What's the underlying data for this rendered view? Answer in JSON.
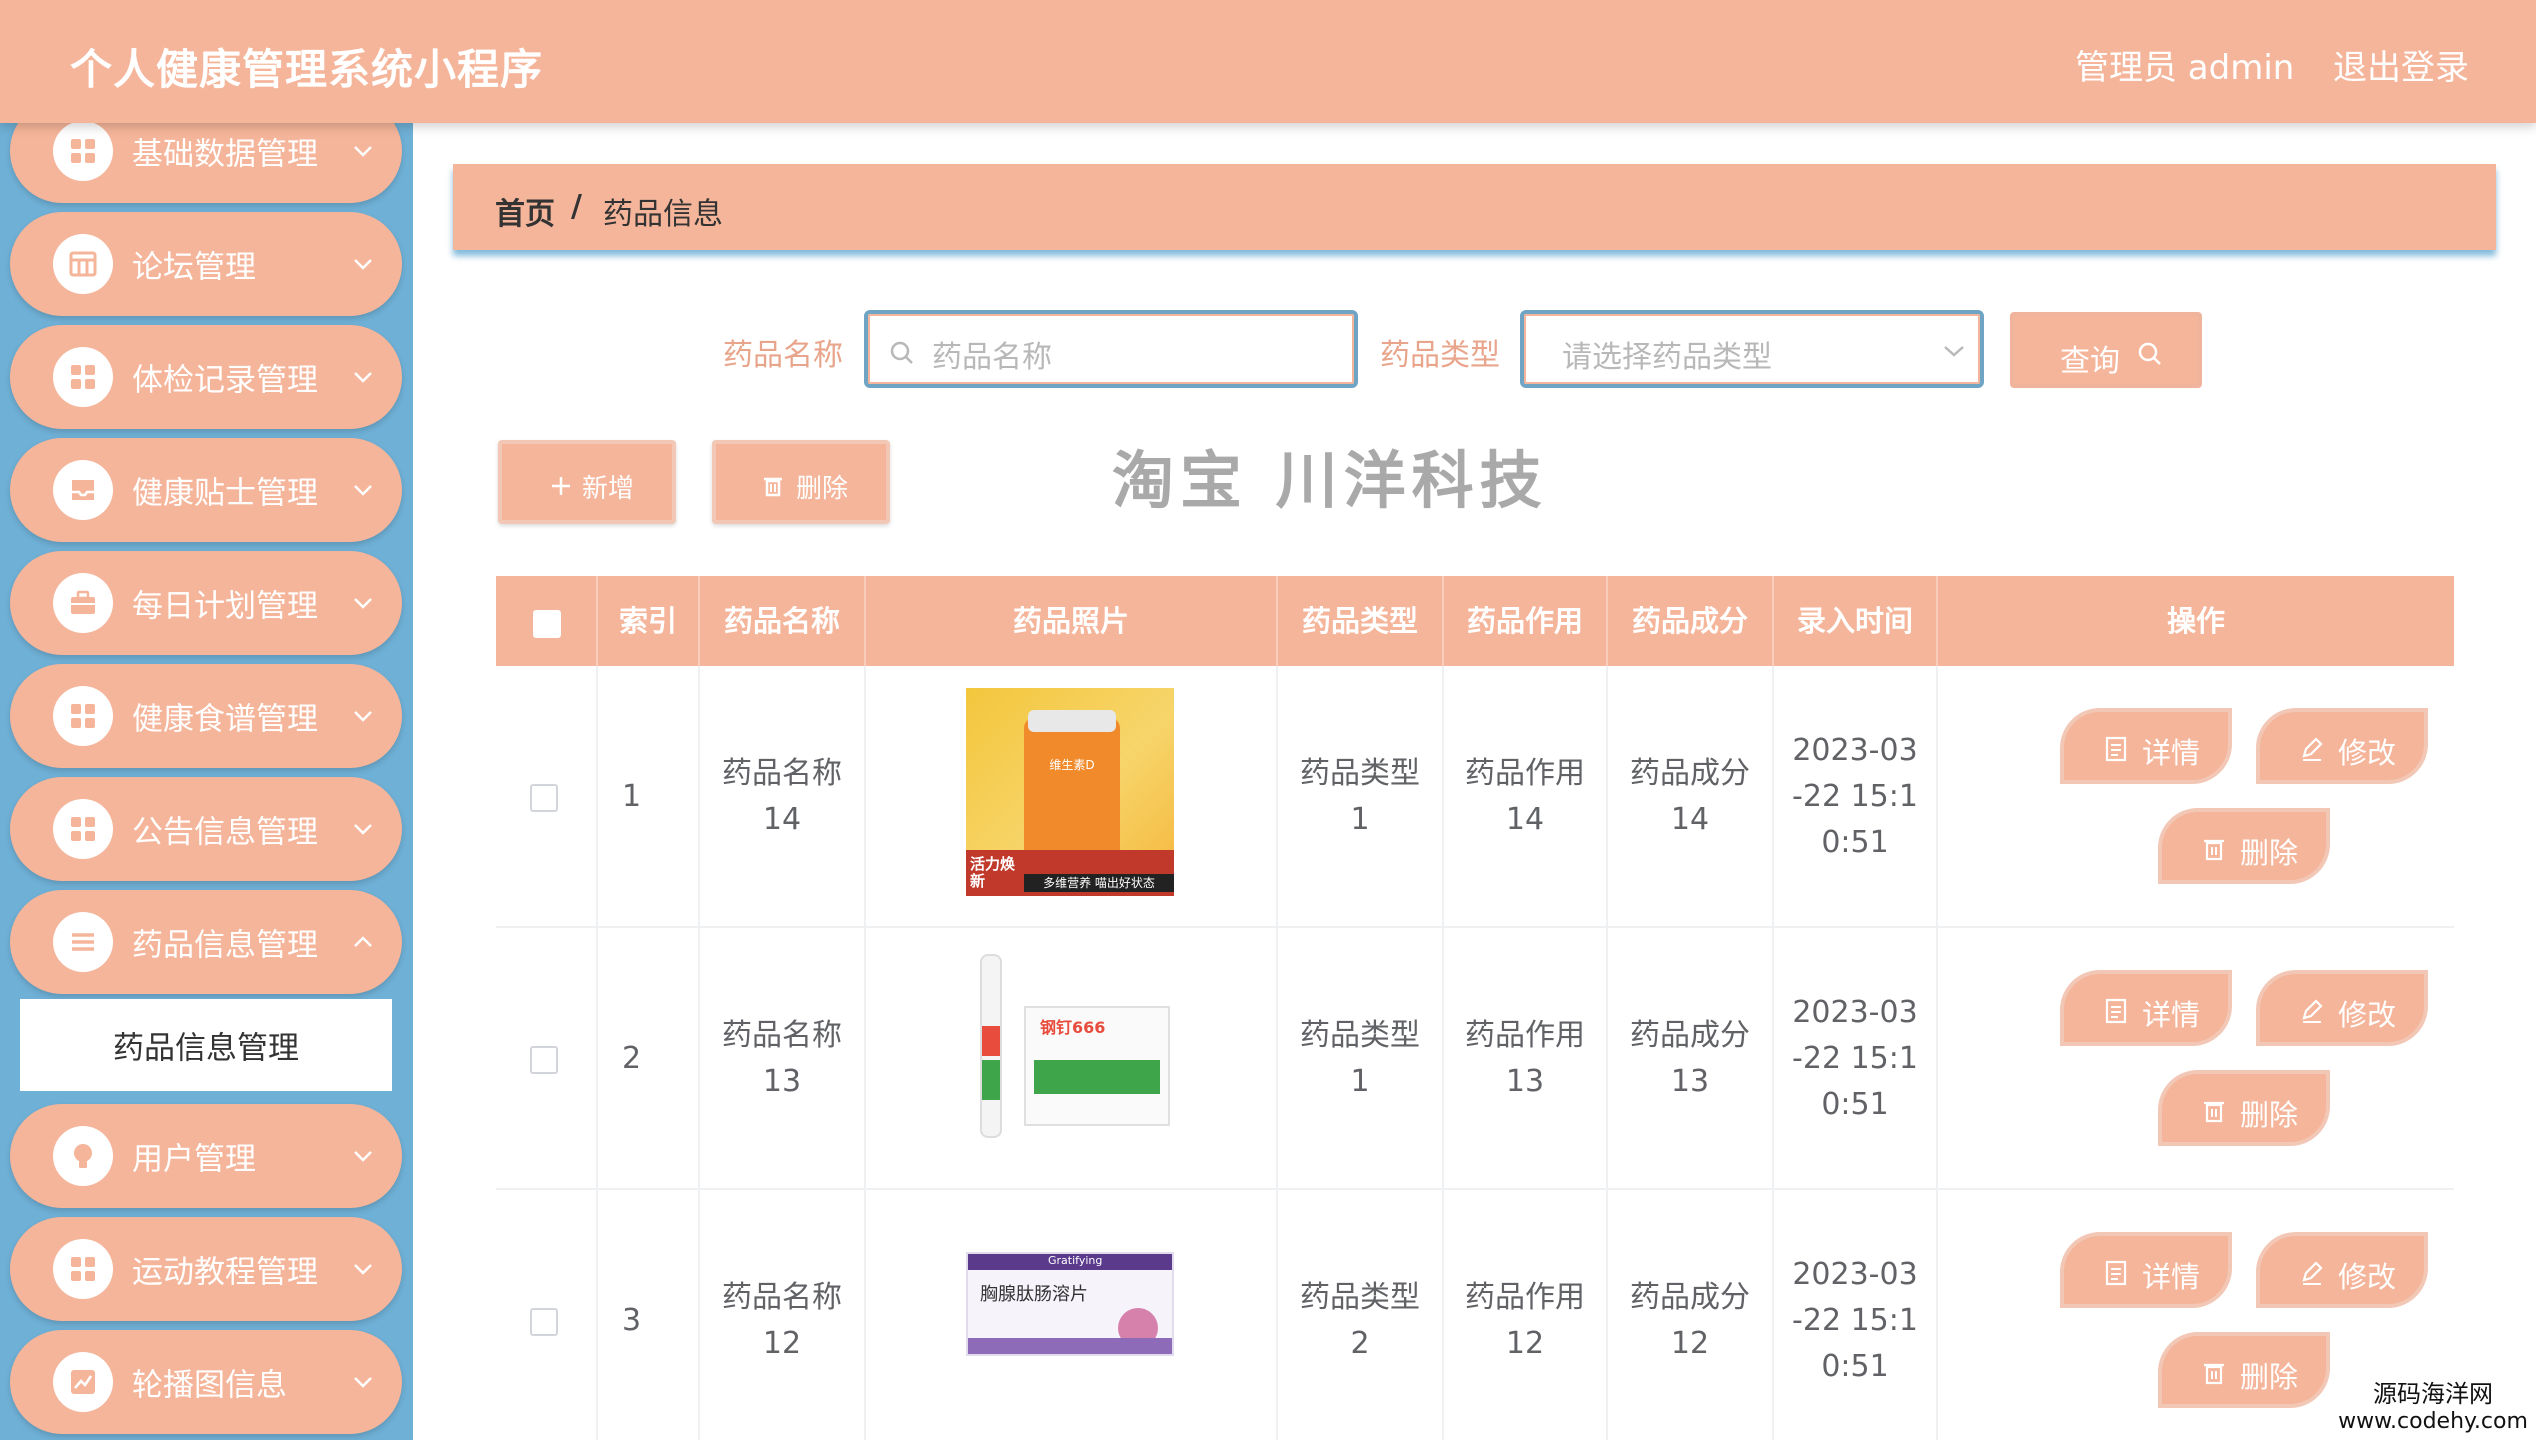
{
  "app": {
    "title": "个人健康管理系统小程序"
  },
  "header": {
    "user_label": "管理员 admin",
    "logout_label": "退出登录"
  },
  "sidebar": {
    "items": [
      {
        "label": "基础数据管理",
        "icon": "grid-icon"
      },
      {
        "label": "论坛管理",
        "icon": "table-icon"
      },
      {
        "label": "体检记录管理",
        "icon": "grid-icon"
      },
      {
        "label": "健康贴士管理",
        "icon": "inbox-icon"
      },
      {
        "label": "每日计划管理",
        "icon": "briefcase-icon"
      },
      {
        "label": "健康食谱管理",
        "icon": "grid-icon"
      },
      {
        "label": "公告信息管理",
        "icon": "grid-icon"
      },
      {
        "label": "药品信息管理",
        "icon": "list-icon"
      },
      {
        "label": "用户管理",
        "icon": "lightbulb-icon"
      },
      {
        "label": "运动教程管理",
        "icon": "grid-icon"
      },
      {
        "label": "轮播图信息",
        "icon": "chart-icon"
      }
    ],
    "active_submenu": "药品信息管理"
  },
  "breadcrumb": {
    "home": "首页",
    "separator": "/",
    "current": "药品信息"
  },
  "search": {
    "name_label": "药品名称",
    "name_placeholder": "药品名称",
    "type_label": "药品类型",
    "type_placeholder": "请选择药品类型",
    "query_label": "查询"
  },
  "actions": {
    "add_label": "新增",
    "delete_label": "删除"
  },
  "watermark": "淘宝 川洋科技",
  "table": {
    "columns": [
      "索引",
      "药品名称",
      "药品照片",
      "药品类型",
      "药品作用",
      "药品成分",
      "录入时间",
      "操作"
    ],
    "op_labels": {
      "detail": "详情",
      "edit": "修改",
      "delete": "删除"
    },
    "rows": [
      {
        "index": "1",
        "name": "药品名称14",
        "type": "药品类型1",
        "effect": "药品作用14",
        "ingredient": "药品成分14",
        "time": "2023-03-22 15:10:51",
        "photo_texts": [
          "维生素D",
          "活力焕新",
          "多维营养 喵出好状态"
        ]
      },
      {
        "index": "2",
        "name": "药品名称13",
        "type": "药品类型1",
        "effect": "药品作用13",
        "ingredient": "药品成分13",
        "time": "2023-03-22 15:10:51",
        "photo_texts": [
          "钢钉666"
        ]
      },
      {
        "index": "3",
        "name": "药品名称12",
        "type": "药品类型2",
        "effect": "药品作用12",
        "ingredient": "药品成分12",
        "time": "2023-03-22 15:10:51",
        "photo_texts": [
          "Gratifying",
          "胸腺肽肠溶片"
        ]
      }
    ]
  },
  "site_mark": {
    "name": "源码海洋网",
    "url": "www.codehy.com"
  }
}
